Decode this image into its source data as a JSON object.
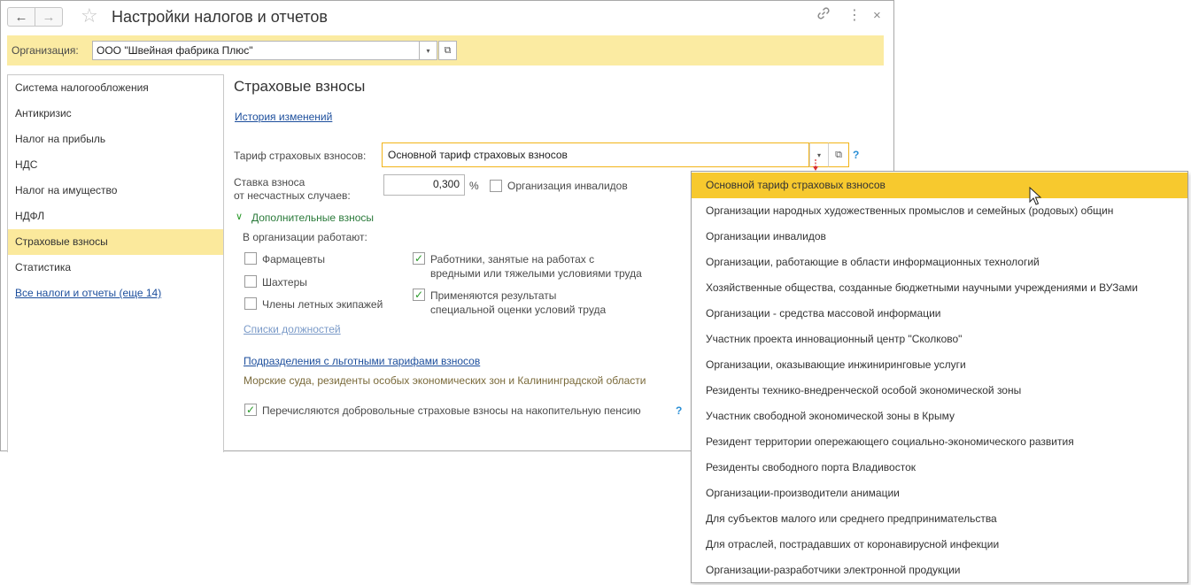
{
  "window": {
    "title": "Настройки налогов и отчетов"
  },
  "icons": {
    "back": "←",
    "forward": "→",
    "favorite": "☆",
    "link": "🔗",
    "more": "⋮",
    "close": "×",
    "dropdown": "▾",
    "open": "⧉",
    "expand": "∨",
    "check": "✓",
    "help": "?"
  },
  "org": {
    "label": "Организация:",
    "value": "ООО \"Швейная фабрика Плюс\""
  },
  "sidebar": {
    "items": [
      {
        "label": "Система налогообложения"
      },
      {
        "label": "Антикризис"
      },
      {
        "label": "Налог на прибыль"
      },
      {
        "label": "НДС"
      },
      {
        "label": "Налог на имущество"
      },
      {
        "label": "НДФЛ"
      },
      {
        "label": "Страховые взносы"
      },
      {
        "label": "Статистика"
      }
    ],
    "all_link": "Все налоги и отчеты (еще 14)"
  },
  "main": {
    "title": "Страховые взносы",
    "history_link": "История изменений",
    "tariff_label": "Тариф страховых взносов:",
    "tariff_value": "Основной тариф страховых взносов",
    "rate_label_1": "Ставка взноса",
    "rate_label_2": "от несчастных случаев:",
    "rate_value": "0,300",
    "rate_unit": "%",
    "disabled_org_label": "Организация инвалидов",
    "extra_group": "Дополнительные взносы",
    "works_label": "В организации работают:",
    "cb_pharma": "Фармацевты",
    "cb_miners": "Шахтеры",
    "cb_flight": "Члены летных экипажей",
    "cb_harmful_1": "Работники, занятые на работах с",
    "cb_harmful_2": "вредными или тяжелыми условиями труда",
    "cb_special_1": "Применяются результаты",
    "cb_special_2": "специальной оценки условий труда",
    "positions_link": "Списки должностей",
    "divisions_link": "Подразделения с льготными тарифами взносов",
    "divisions_note": "Морские суда, резиденты особых экономических зон и Калининградской области",
    "voluntary_label": "Перечисляются добровольные страховые взносы на накопительную пенсию"
  },
  "dropdown": {
    "items": [
      "Основной тариф страховых взносов",
      "Организации народных художественных промыслов и семейных (родовых) общин",
      "Организации инвалидов",
      "Организации, работающие в области информационных технологий",
      "Хозяйственные общества, созданные бюджетными научными учреждениями и ВУЗами",
      "Организации - средства массовой информации",
      "Участник проекта инновационный центр \"Сколково\"",
      "Организации, оказывающие инжиниринговые услуги",
      "Резиденты технико-внедренческой особой экономической зоны",
      "Участник свободной экономической зоны в Крыму",
      "Резидент территории опережающего социально-экономического развития",
      "Резиденты свободного порта Владивосток",
      "Организации-производители анимации",
      "Для субъектов малого или среднего предпринимательства",
      "Для отраслей, пострадавших от коронавирусной инфекции",
      "Организации-разработчики электронной продукции"
    ]
  }
}
